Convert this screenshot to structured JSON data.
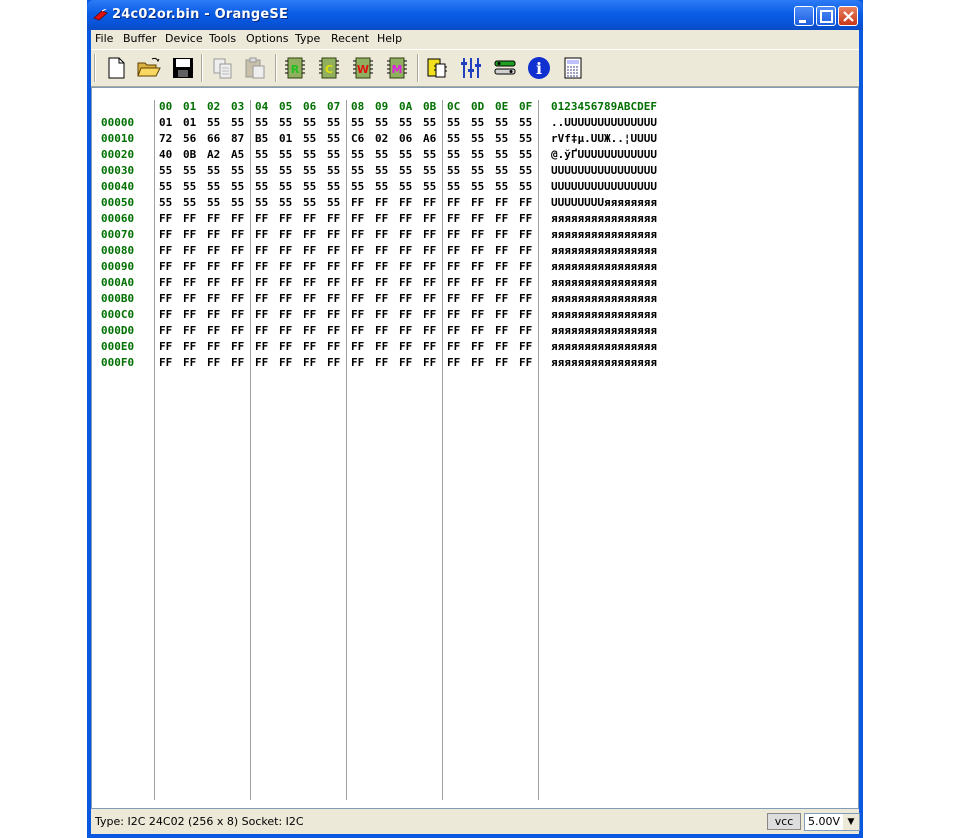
{
  "window": {
    "title": "24c02or.bin - OrangeSE"
  },
  "menu": [
    "File",
    "Buffer",
    "Device",
    "Tools",
    "Options",
    "Type",
    "Recent",
    "Help"
  ],
  "toolbar": {
    "icons": [
      "new-file-icon",
      "open-folder-icon",
      "save-disk-icon",
      "copy-icon",
      "paste-icon",
      "read-chip-icon",
      "check-chip-icon",
      "write-chip-icon",
      "modify-chip-icon",
      "clipboard-chip-icon",
      "settings-sliders-icon",
      "device-config-icon",
      "info-icon",
      "calculator-icon"
    ],
    "labels": {
      "read": "R",
      "check": "C",
      "write": "W",
      "modify": "M",
      "info": "i"
    }
  },
  "hex": {
    "column_headers": [
      "00",
      "01",
      "02",
      "03",
      "04",
      "05",
      "06",
      "07",
      "08",
      "09",
      "0A",
      "0B",
      "0C",
      "0D",
      "0E",
      "0F"
    ],
    "ascii_header": "0123456789ABCDEF",
    "rows": [
      {
        "addr": "00000",
        "bytes": [
          "01",
          "01",
          "55",
          "55",
          "55",
          "55",
          "55",
          "55",
          "55",
          "55",
          "55",
          "55",
          "55",
          "55",
          "55",
          "55"
        ],
        "ascii": "..UUUUUUUUUUUUUU"
      },
      {
        "addr": "00010",
        "bytes": [
          "72",
          "56",
          "66",
          "87",
          "B5",
          "01",
          "55",
          "55",
          "C6",
          "02",
          "06",
          "A6",
          "55",
          "55",
          "55",
          "55"
        ],
        "ascii": "rVf‡µ.UUЖ..¦UUUU"
      },
      {
        "addr": "00020",
        "bytes": [
          "40",
          "0B",
          "A2",
          "A5",
          "55",
          "55",
          "55",
          "55",
          "55",
          "55",
          "55",
          "55",
          "55",
          "55",
          "55",
          "55"
        ],
        "ascii": "@.ўҐUUUUUUUUUUUU"
      },
      {
        "addr": "00030",
        "bytes": [
          "55",
          "55",
          "55",
          "55",
          "55",
          "55",
          "55",
          "55",
          "55",
          "55",
          "55",
          "55",
          "55",
          "55",
          "55",
          "55"
        ],
        "ascii": "UUUUUUUUUUUUUUUU"
      },
      {
        "addr": "00040",
        "bytes": [
          "55",
          "55",
          "55",
          "55",
          "55",
          "55",
          "55",
          "55",
          "55",
          "55",
          "55",
          "55",
          "55",
          "55",
          "55",
          "55"
        ],
        "ascii": "UUUUUUUUUUUUUUUU"
      },
      {
        "addr": "00050",
        "bytes": [
          "55",
          "55",
          "55",
          "55",
          "55",
          "55",
          "55",
          "55",
          "FF",
          "FF",
          "FF",
          "FF",
          "FF",
          "FF",
          "FF",
          "FF"
        ],
        "ascii": "UUUUUUUUяяяяяяяя"
      },
      {
        "addr": "00060",
        "bytes": [
          "FF",
          "FF",
          "FF",
          "FF",
          "FF",
          "FF",
          "FF",
          "FF",
          "FF",
          "FF",
          "FF",
          "FF",
          "FF",
          "FF",
          "FF",
          "FF"
        ],
        "ascii": "яяяяяяяяяяяяяяяя"
      },
      {
        "addr": "00070",
        "bytes": [
          "FF",
          "FF",
          "FF",
          "FF",
          "FF",
          "FF",
          "FF",
          "FF",
          "FF",
          "FF",
          "FF",
          "FF",
          "FF",
          "FF",
          "FF",
          "FF"
        ],
        "ascii": "яяяяяяяяяяяяяяяя"
      },
      {
        "addr": "00080",
        "bytes": [
          "FF",
          "FF",
          "FF",
          "FF",
          "FF",
          "FF",
          "FF",
          "FF",
          "FF",
          "FF",
          "FF",
          "FF",
          "FF",
          "FF",
          "FF",
          "FF"
        ],
        "ascii": "яяяяяяяяяяяяяяяя"
      },
      {
        "addr": "00090",
        "bytes": [
          "FF",
          "FF",
          "FF",
          "FF",
          "FF",
          "FF",
          "FF",
          "FF",
          "FF",
          "FF",
          "FF",
          "FF",
          "FF",
          "FF",
          "FF",
          "FF"
        ],
        "ascii": "яяяяяяяяяяяяяяяя"
      },
      {
        "addr": "000A0",
        "bytes": [
          "FF",
          "FF",
          "FF",
          "FF",
          "FF",
          "FF",
          "FF",
          "FF",
          "FF",
          "FF",
          "FF",
          "FF",
          "FF",
          "FF",
          "FF",
          "FF"
        ],
        "ascii": "яяяяяяяяяяяяяяяя"
      },
      {
        "addr": "000B0",
        "bytes": [
          "FF",
          "FF",
          "FF",
          "FF",
          "FF",
          "FF",
          "FF",
          "FF",
          "FF",
          "FF",
          "FF",
          "FF",
          "FF",
          "FF",
          "FF",
          "FF"
        ],
        "ascii": "яяяяяяяяяяяяяяяя"
      },
      {
        "addr": "000C0",
        "bytes": [
          "FF",
          "FF",
          "FF",
          "FF",
          "FF",
          "FF",
          "FF",
          "FF",
          "FF",
          "FF",
          "FF",
          "FF",
          "FF",
          "FF",
          "FF",
          "FF"
        ],
        "ascii": "яяяяяяяяяяяяяяяя"
      },
      {
        "addr": "000D0",
        "bytes": [
          "FF",
          "FF",
          "FF",
          "FF",
          "FF",
          "FF",
          "FF",
          "FF",
          "FF",
          "FF",
          "FF",
          "FF",
          "FF",
          "FF",
          "FF",
          "FF"
        ],
        "ascii": "яяяяяяяяяяяяяяяя"
      },
      {
        "addr": "000E0",
        "bytes": [
          "FF",
          "FF",
          "FF",
          "FF",
          "FF",
          "FF",
          "FF",
          "FF",
          "FF",
          "FF",
          "FF",
          "FF",
          "FF",
          "FF",
          "FF",
          "FF"
        ],
        "ascii": "яяяяяяяяяяяяяяяя"
      },
      {
        "addr": "000F0",
        "bytes": [
          "FF",
          "FF",
          "FF",
          "FF",
          "FF",
          "FF",
          "FF",
          "FF",
          "FF",
          "FF",
          "FF",
          "FF",
          "FF",
          "FF",
          "FF",
          "FF"
        ],
        "ascii": "яяяяяяяяяяяяяяяя"
      }
    ]
  },
  "status": {
    "text": "Type: I2C 24C02 (256 x 8)   Socket: I2C",
    "vcc_label": "vcc",
    "voltage": "5.00V"
  },
  "colors": {
    "title_bar": "#0a5de6",
    "hex_header": "#007000",
    "chrome": "#ece9d8"
  }
}
